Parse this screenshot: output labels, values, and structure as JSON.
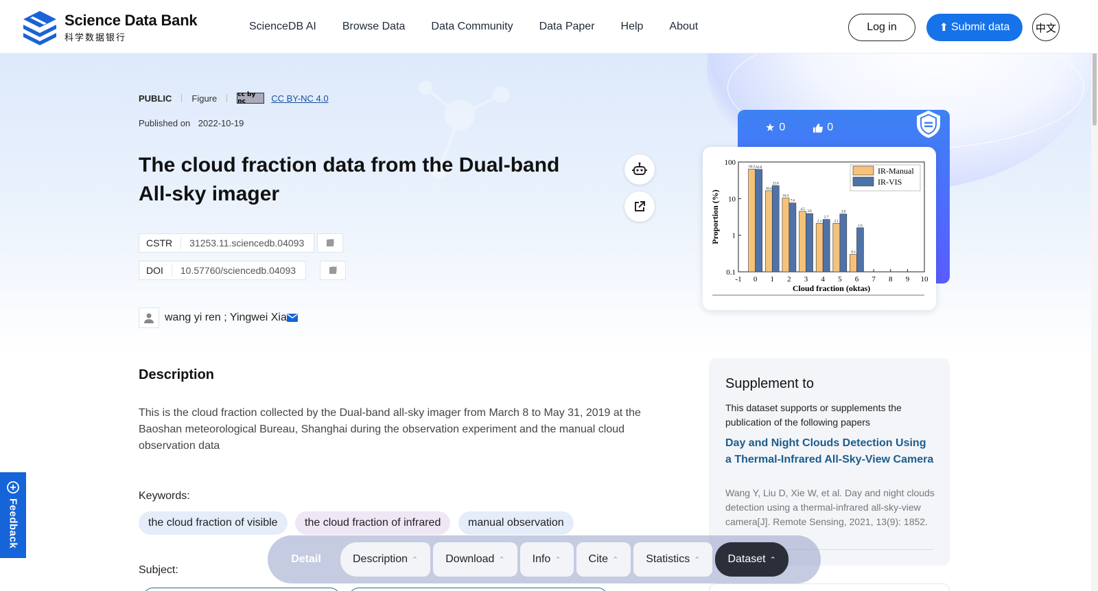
{
  "brand": {
    "name_en": "Science Data Bank",
    "name_cn": "科学数据银行",
    "color": "#1672e8"
  },
  "nav": {
    "items": [
      "ScienceDB AI",
      "Browse Data",
      "Data Community",
      "Data Paper",
      "Help",
      "About"
    ]
  },
  "header": {
    "login": "Log in",
    "submit": "Submit data",
    "lang": "中文"
  },
  "meta": {
    "visibility": "PUBLIC",
    "type": "Figure",
    "license": "CC BY-NC 4.0",
    "cc_badge": "cc by nc",
    "published_label": "Published on",
    "published_date": "2022-10-19"
  },
  "title": "The cloud fraction data from the Dual-band All-sky imager",
  "ids": {
    "cstr_label": "CSTR",
    "cstr_value": "31253.11.sciencedb.04093",
    "doi_label": "DOI",
    "doi_value": "10.57760/sciencedb.04093"
  },
  "authors": "wang yi ren ; Yingwei Xia",
  "stats": {
    "stars": "0",
    "likes": "0"
  },
  "description": {
    "heading": "Description",
    "text": "This is the cloud fraction collected by the Dual-band all-sky imager from March 8 to May 31, 2019 at the Baoshan meteorological Bureau, Shanghai during the observation experiment and the manual cloud observation data",
    "keywords_label": "Keywords:",
    "keywords": [
      "the cloud fraction of visible",
      "the cloud fraction of infrared",
      "manual observation"
    ],
    "subject_label": "Subject:"
  },
  "supplement": {
    "heading": "Supplement to",
    "subtitle": "This dataset supports or supplements the publication of the following papers",
    "paper_title": "Day and Night Clouds Detection Using a Thermal-Infrared All-Sky-View Camera",
    "citation": "Wang Y, Liu D, Xie W, et al. Day and night clouds detection using a thermal-infrared all-sky-view camera[J]. Remote Sensing, 2021, 13(9): 1852."
  },
  "toolbar": {
    "detail": "Detail",
    "items": [
      "Description",
      "Download",
      "Info",
      "Cite",
      "Statistics",
      "Dataset"
    ]
  },
  "feedback": "Feedback",
  "chart_data": {
    "type": "bar",
    "xlabel": "Cloud fraction (oktas)",
    "ylabel": "Proportion (%)",
    "yscale": "log",
    "ylim": [
      0.1,
      100
    ],
    "xlim": [
      -1,
      10
    ],
    "x_ticks": [
      "-1",
      "0",
      "1",
      "2",
      "3",
      "4",
      "5",
      "6",
      "7",
      "8",
      "9",
      "10"
    ],
    "y_ticks": [
      "0.1",
      "1",
      "10",
      "100"
    ],
    "categories": [
      "0",
      "1",
      "2",
      "3",
      "4",
      "5",
      "6"
    ],
    "series": [
      {
        "name": "IR-Manual",
        "color": "#f6c27a",
        "values": [
          64.3,
          16.4,
          10.3,
          4.5,
          2.1,
          2.1,
          0.3
        ]
      },
      {
        "name": "IR-VIS",
        "color": "#4f72a8",
        "values": [
          62.8,
          22.6,
          7.6,
          3.9,
          2.7,
          3.8,
          1.6
        ]
      }
    ],
    "data_labels": {
      "IR-Manual": [
        "64.3",
        "16.4",
        "10.3",
        "4.5",
        "2.1",
        "2.1",
        "0.3"
      ],
      "IR-VIS": [
        "62.8",
        "22.6",
        "7.6",
        "3.9",
        "2.7",
        "3.8",
        "1.6"
      ]
    },
    "legend_position": "top-right"
  }
}
